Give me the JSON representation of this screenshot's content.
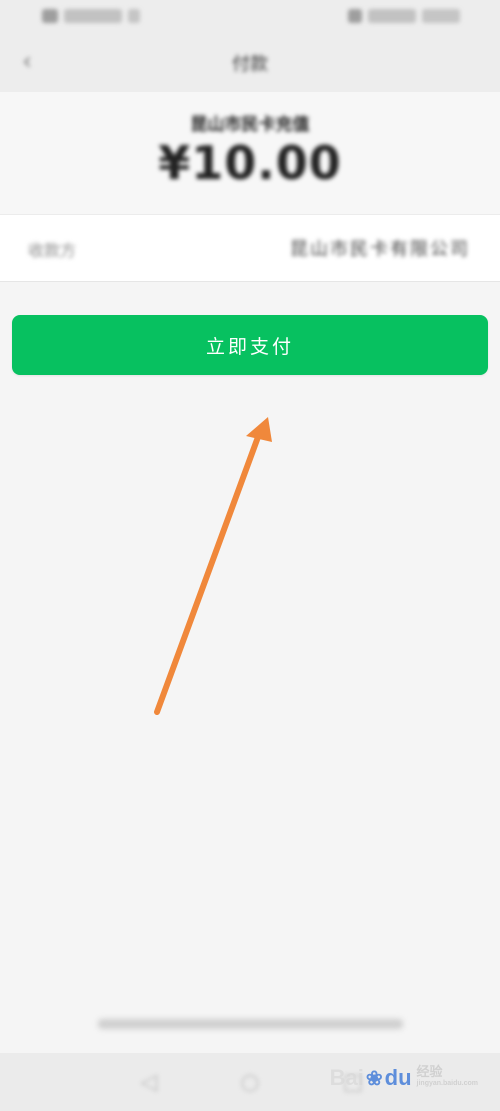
{
  "status_bar": {
    "left_text": "",
    "right_text": ""
  },
  "nav": {
    "title": "付款"
  },
  "payment": {
    "merchant_subtitle": "昆山市民卡充值",
    "amount": "¥10.00"
  },
  "payee": {
    "label": "收款方",
    "value": "昆山市民卡有限公司"
  },
  "pay_button": {
    "label": "立即支付"
  },
  "footer": {
    "note": ""
  },
  "watermark": {
    "brand_left": "Bai",
    "brand_right": "du",
    "sub": "经验",
    "sub_small": "jingyan.baidu.com"
  },
  "colors": {
    "accent_green": "#07c160",
    "arrow_orange": "#f0883b",
    "background": "#f5f5f5"
  },
  "icons": {
    "back": "back-arrow-icon",
    "nav_back": "nav-back-icon",
    "nav_home": "nav-home-icon",
    "nav_recent": "nav-recent-icon",
    "annotation": "orange-arrow-icon"
  }
}
